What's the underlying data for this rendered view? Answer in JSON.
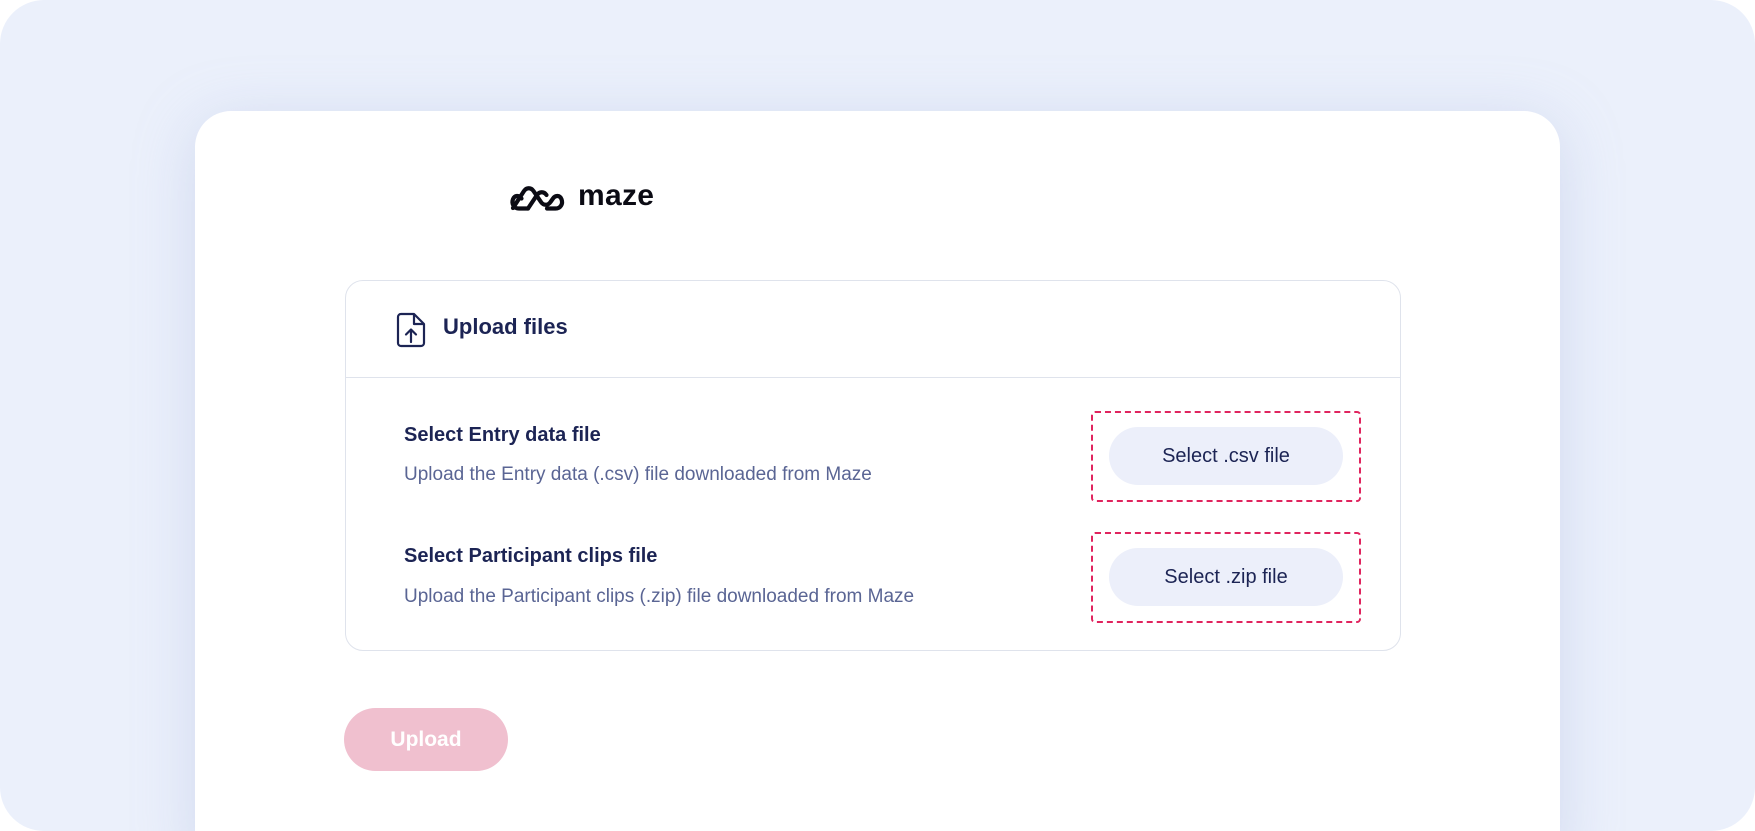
{
  "brand": {
    "name": "maze",
    "logo_icon": "maze-logo-icon",
    "accent_color": "#e0245e"
  },
  "panel": {
    "title": "Upload files",
    "icon": "file-upload-icon",
    "rows": [
      {
        "title": "Select Entry data file",
        "description": "Upload the Entry data (.csv) file downloaded from Maze",
        "button_label": "Select .csv file"
      },
      {
        "title": "Select Participant clips file",
        "description": "Upload the Participant clips (.zip) file downloaded from Maze",
        "button_label": "Select .zip file"
      }
    ]
  },
  "actions": {
    "upload_label": "Upload",
    "upload_disabled": true
  }
}
